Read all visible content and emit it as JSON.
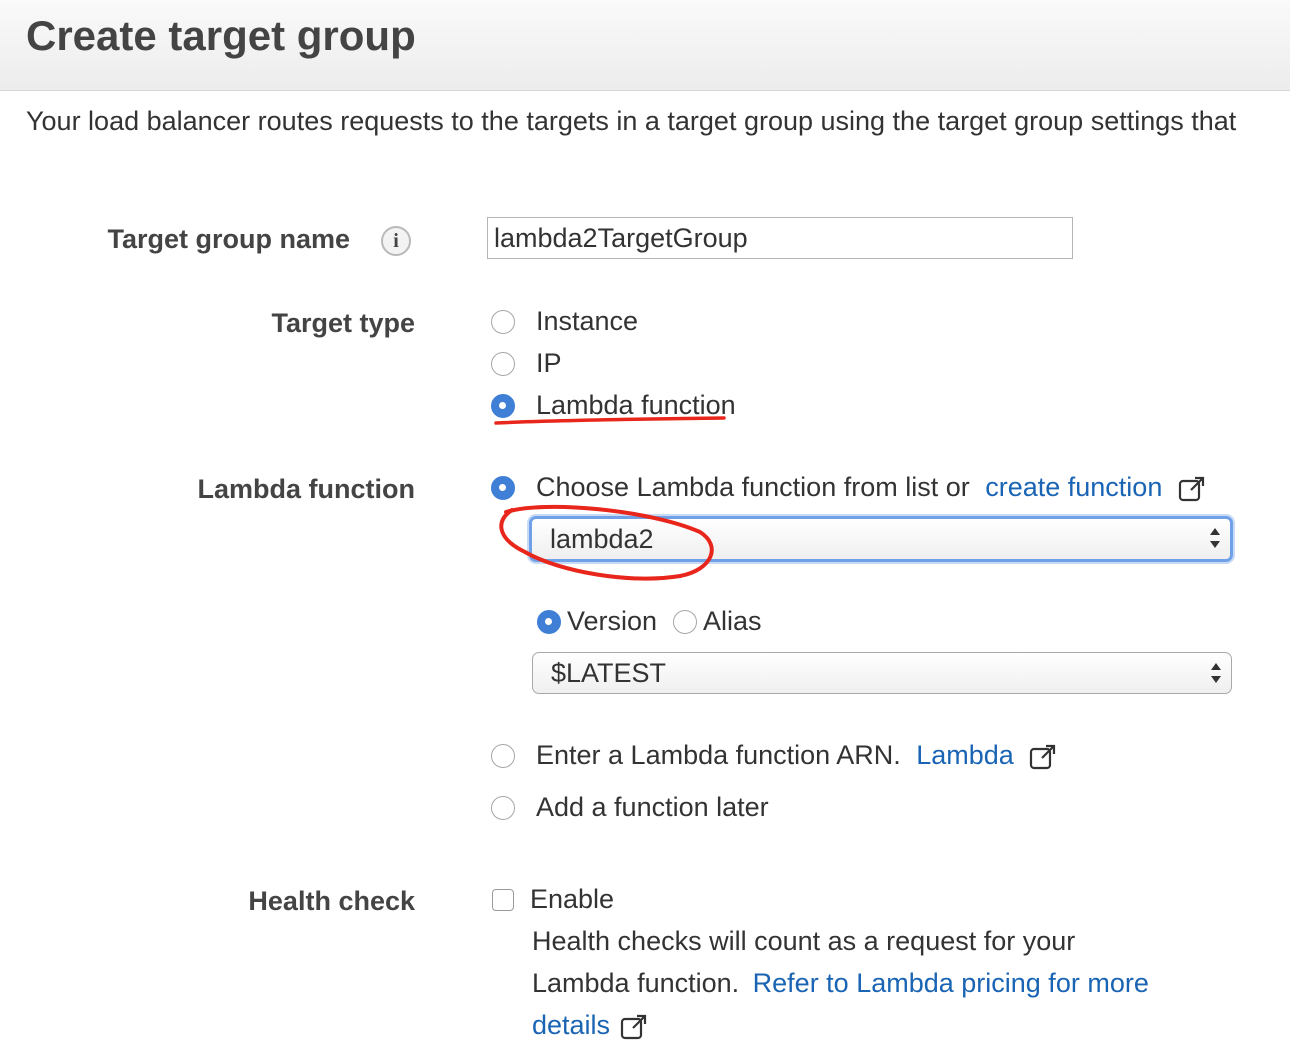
{
  "page": {
    "title": "Create target group",
    "description": "Your load balancer routes requests to the targets in a target group using the target group settings that"
  },
  "target_group_name": {
    "label": "Target group name",
    "value": "lambda2TargetGroup",
    "info_icon": "info-icon"
  },
  "target_type": {
    "label": "Target type",
    "options": [
      "Instance",
      "IP",
      "Lambda function"
    ],
    "selected": "Lambda function"
  },
  "lambda_function": {
    "label": "Lambda function",
    "choose_option": "Choose Lambda function from list or",
    "create_link": "create function",
    "selected_function": "lambda2",
    "version_option": "Version",
    "alias_option": "Alias",
    "version_value": "$LATEST",
    "arn_option": "Enter a Lambda function ARN.",
    "arn_link": "Lambda",
    "later_option": "Add a function later"
  },
  "health_check": {
    "label": "Health check",
    "enable_label": "Enable",
    "enabled": false,
    "note_line1": "Health checks will count as a request for your",
    "note_line2": "Lambda function.",
    "pricing_link_part1": "Refer to Lambda pricing for more",
    "pricing_link_part2": "details"
  },
  "annotation_color": "#e8261b",
  "accent_color": "#3f7fd6",
  "link_color": "#1a64b4"
}
